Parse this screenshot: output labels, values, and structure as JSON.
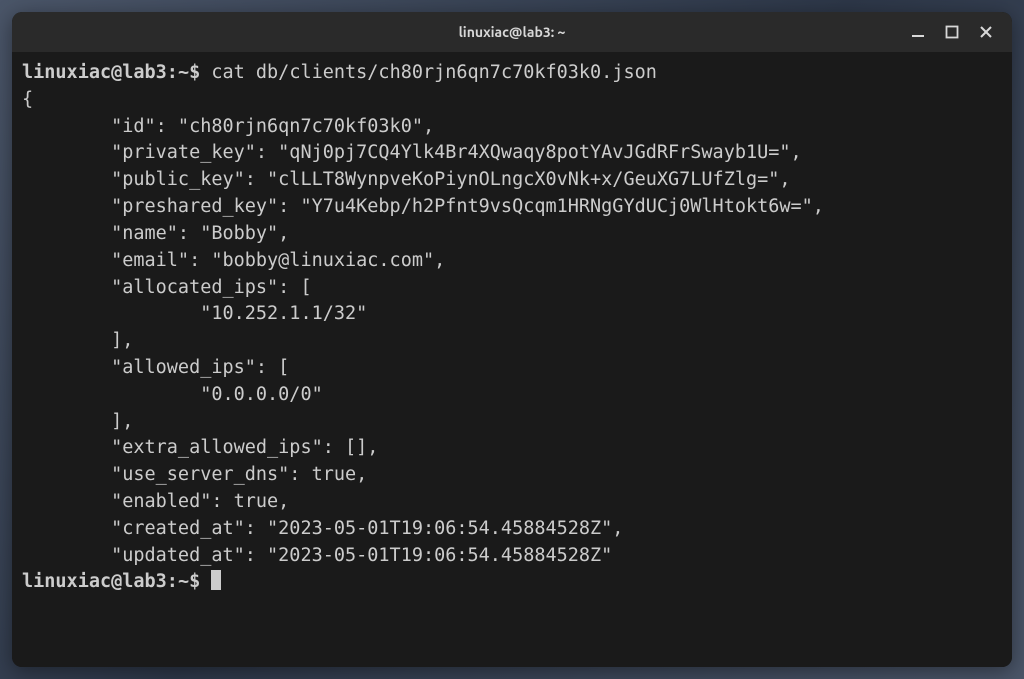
{
  "window": {
    "title": "linuxiac@lab3: ~"
  },
  "prompt": {
    "user": "linuxiac@lab3",
    "sep": ":",
    "path": "~",
    "dollar": "$"
  },
  "command": "cat db/clients/ch80rjn6qn7c70kf03k0.json",
  "output": "{\n        \"id\": \"ch80rjn6qn7c70kf03k0\",\n        \"private_key\": \"qNj0pj7CQ4Ylk4Br4XQwaqy8potYAvJGdRFrSwayb1U=\",\n        \"public_key\": \"clLLT8WynpveKoPiynOLngcX0vNk+x/GeuXG7LUfZlg=\",\n        \"preshared_key\": \"Y7u4Kebp/h2Pfnt9vsQcqm1HRNgGYdUCj0WlHtokt6w=\",\n        \"name\": \"Bobby\",\n        \"email\": \"bobby@linuxiac.com\",\n        \"allocated_ips\": [\n                \"10.252.1.1/32\"\n        ],\n        \"allowed_ips\": [\n                \"0.0.0.0/0\"\n        ],\n        \"extra_allowed_ips\": [],\n        \"use_server_dns\": true,\n        \"enabled\": true,\n        \"created_at\": \"2023-05-01T19:06:54.45884528Z\",\n        \"updated_at\": \"2023-05-01T19:06:54.45884528Z\""
}
